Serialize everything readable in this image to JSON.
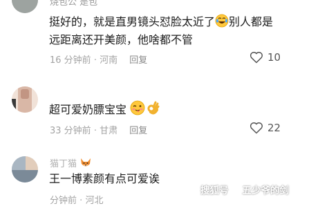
{
  "comments": [
    {
      "username": "烧包公 是包",
      "text_line1": "挺好的，就是直男镜头怼脸太近了",
      "text_line1_tail": "别人都是",
      "text_line2": "远距离还开美颜，他啥都不管",
      "time": "16 分钟前",
      "location": "河南",
      "reply_label": "回复",
      "likes": "10",
      "emoji_icon": "laughing-tears-emoji"
    },
    {
      "username": "",
      "text": "超可爱奶膘宝宝",
      "time": "33 分钟前",
      "location": "甘肃",
      "reply_label": "回复",
      "likes": "22",
      "emoji_icons": [
        "blush-tongue-emoji",
        "ok-hand-emoji"
      ]
    },
    {
      "username": "猫丁猫",
      "text": "王一博素颜有点可爱诶",
      "time": "分钟前",
      "location": "河北",
      "reply_label": "回复",
      "likes": "",
      "emoji_icon": "fox-emoji"
    }
  ],
  "separator": "·",
  "watermark": {
    "prefix": "搜狐号",
    "author": "五少爷的剑"
  },
  "colors": {
    "meta": "#a3a3a3",
    "text": "#1b1b1b",
    "like_icon": "#555555"
  }
}
